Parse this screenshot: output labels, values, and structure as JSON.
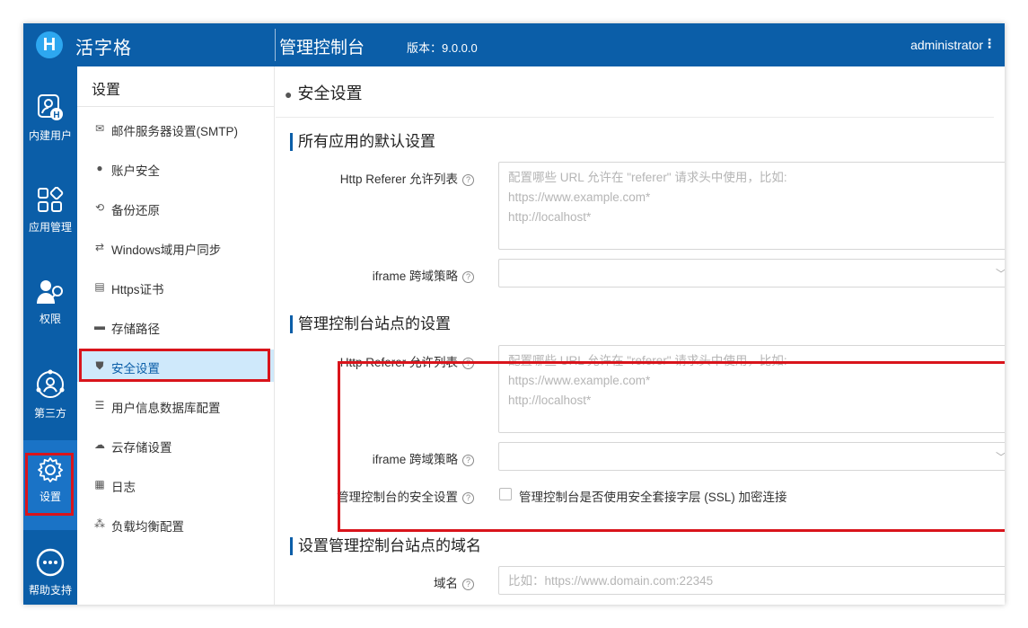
{
  "header": {
    "logo_letter": "H",
    "app_name": "活字格",
    "console_title": "管理控制台",
    "version": "版本：9.0.0.0",
    "user": "administrator",
    "menu_icon": "⋮"
  },
  "leftnav": [
    {
      "label": "内建用户",
      "icon": "user-badge-icon"
    },
    {
      "label": "应用管理",
      "icon": "app-grid-icon"
    },
    {
      "label": "权限",
      "icon": "user-key-icon"
    },
    {
      "label": "第三方",
      "icon": "third-party-icon"
    },
    {
      "label": "设置",
      "icon": "gear-icon"
    },
    {
      "label": "帮助支持",
      "icon": "more-icon"
    }
  ],
  "submenu": {
    "header": "设置",
    "items": [
      {
        "label": "邮件服务器设置(SMTP)",
        "icon": "mail-icon"
      },
      {
        "label": "账户安全",
        "icon": "user-lock-icon"
      },
      {
        "label": "备份还原",
        "icon": "backup-icon"
      },
      {
        "label": "Windows域用户同步",
        "icon": "sync-icon"
      },
      {
        "label": "Https证书",
        "icon": "certificate-icon"
      },
      {
        "label": "存储路径",
        "icon": "folder-icon"
      },
      {
        "label": "安全设置",
        "icon": "shield-icon"
      },
      {
        "label": "用户信息数据库配置",
        "icon": "database-icon"
      },
      {
        "label": "云存储设置",
        "icon": "cloud-icon"
      },
      {
        "label": "日志",
        "icon": "log-icon"
      },
      {
        "label": "负载均衡配置",
        "icon": "load-balance-icon"
      }
    ]
  },
  "main": {
    "page_title": "安全设置",
    "sections": {
      "default_apps": {
        "title": "所有应用的默认设置",
        "referer_label": "Http Referer 允许列表",
        "referer_placeholder": "配置哪些 URL 允许在 \"referer\" 请求头中使用，比如:\nhttps://www.example.com*\nhttp://localhost*",
        "iframe_label": "iframe 跨域策略",
        "iframe_value": ""
      },
      "console_site": {
        "title": "管理控制台站点的设置",
        "referer_label": "Http Referer 允许列表",
        "referer_placeholder": "配置哪些 URL 允许在 \"referer\" 请求头中使用，比如:\nhttps://www.example.com*\nhttp://localhost*",
        "iframe_label": "iframe 跨域策略",
        "iframe_value": "",
        "security_label": "管理控制台的安全设置",
        "ssl_checkbox_label": "管理控制台是否使用安全套接字层 (SSL) 加密连接",
        "ssl_checked": false
      },
      "domain": {
        "title": "设置管理控制台站点的域名",
        "domain_label": "域名",
        "domain_placeholder": "比如：https://www.domain.com:22345",
        "domain_value": ""
      }
    }
  },
  "colors": {
    "brand": "#0b5ea8",
    "highlight": "#d9141b",
    "active_item_bg": "#cfe9fb"
  }
}
